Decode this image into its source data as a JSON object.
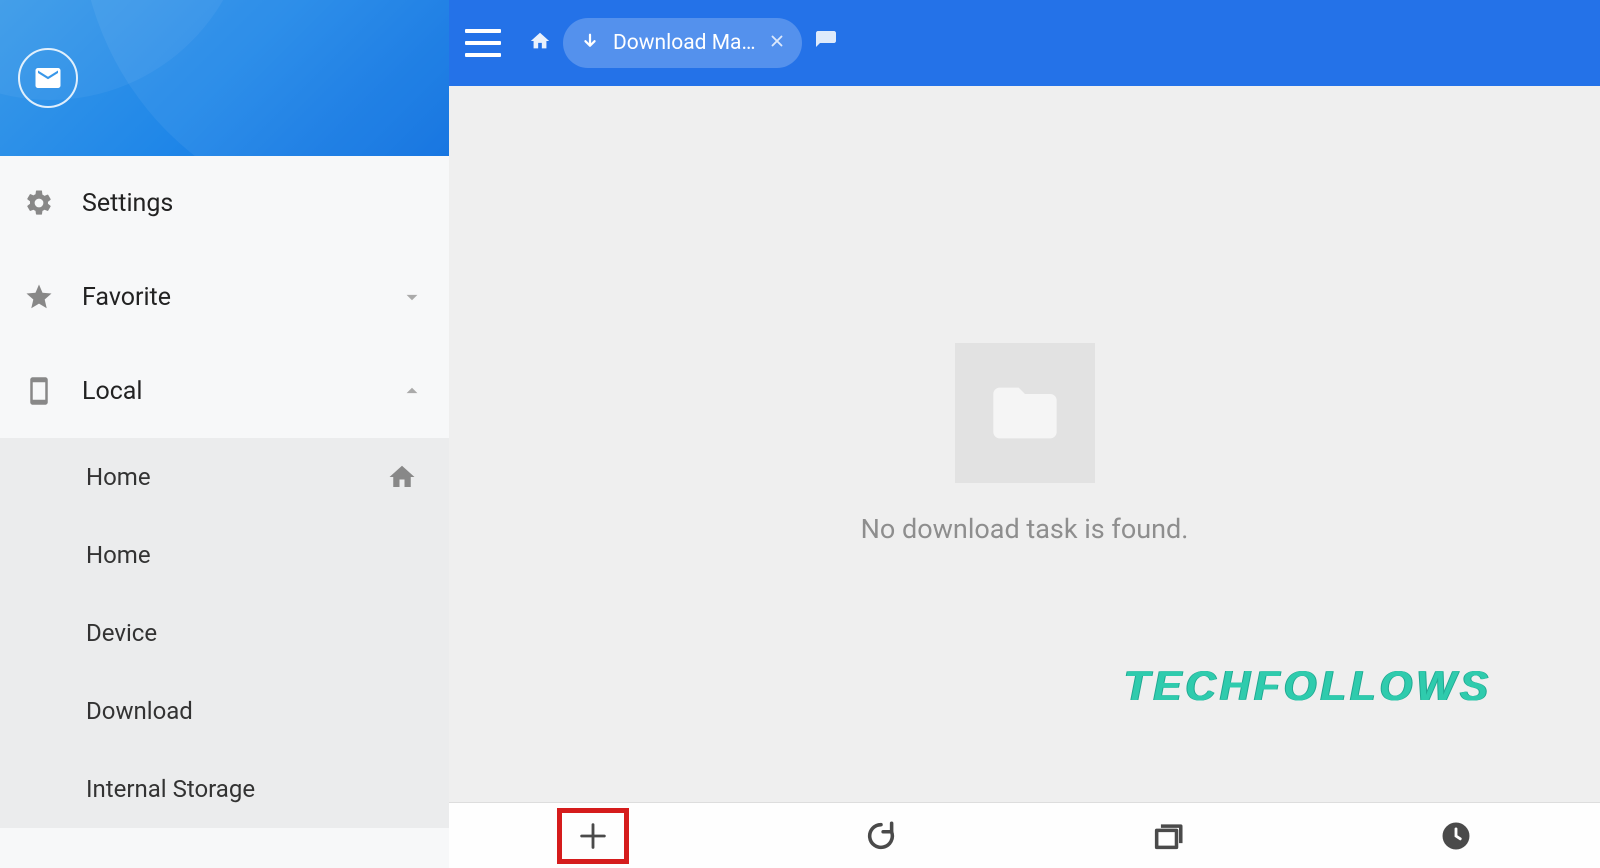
{
  "sidebar": {
    "settings_label": "Settings",
    "favorite_label": "Favorite",
    "local_label": "Local",
    "local_items": {
      "home1": "Home",
      "home2": "Home",
      "device": "Device",
      "download": "Download",
      "internal_storage": "Internal Storage"
    }
  },
  "topbar": {
    "tab_label": "Download Ma…"
  },
  "content": {
    "empty_message": "No download task is found."
  },
  "watermark": "TECHFOLLOWS"
}
